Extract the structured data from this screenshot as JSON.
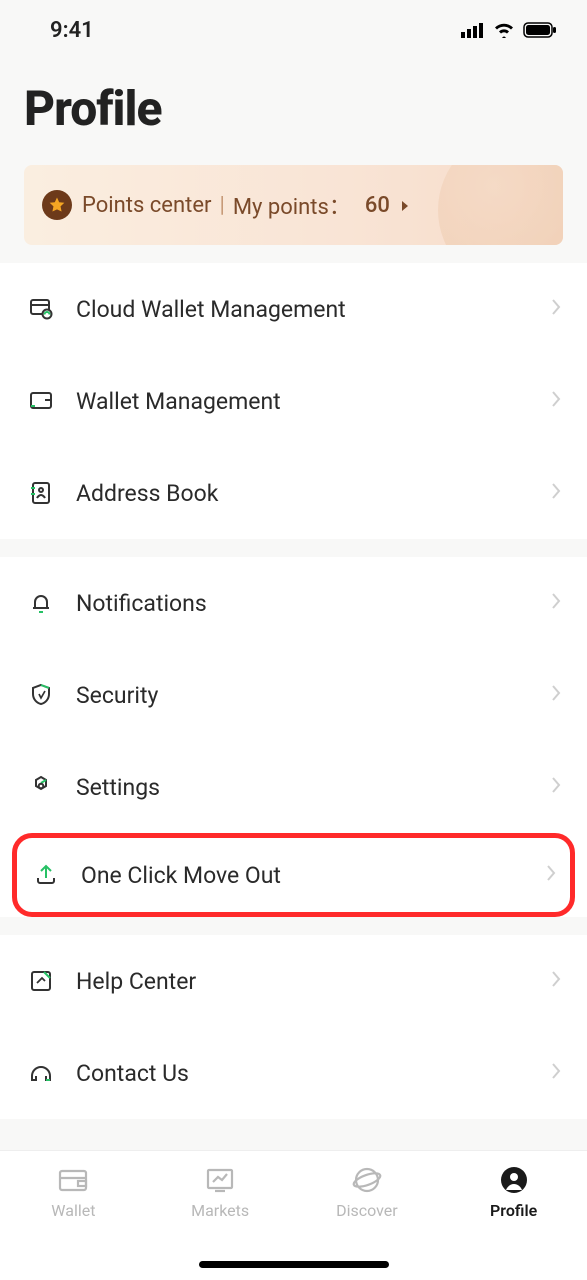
{
  "statusBar": {
    "time": "9:41"
  },
  "pageTitle": "Profile",
  "points": {
    "centerLabel": "Points center",
    "myPointsLabel": "My points：",
    "value": "60"
  },
  "group1": [
    {
      "icon": "cloud-wallet-icon",
      "label": "Cloud Wallet Management"
    },
    {
      "icon": "wallet-mgmt-icon",
      "label": "Wallet Management"
    },
    {
      "icon": "address-book-icon",
      "label": "Address Book"
    }
  ],
  "group2": [
    {
      "icon": "bell-icon",
      "label": "Notifications"
    },
    {
      "icon": "shield-icon",
      "label": "Security"
    },
    {
      "icon": "gear-icon",
      "label": "Settings"
    },
    {
      "icon": "upload-icon",
      "label": "One Click Move Out",
      "highlight": true
    }
  ],
  "group3": [
    {
      "icon": "help-icon",
      "label": "Help Center"
    },
    {
      "icon": "contact-icon",
      "label": "Contact Us"
    }
  ],
  "nav": [
    {
      "icon": "wallet-nav-icon",
      "label": "Wallet",
      "active": false
    },
    {
      "icon": "markets-nav-icon",
      "label": "Markets",
      "active": false
    },
    {
      "icon": "discover-nav-icon",
      "label": "Discover",
      "active": false
    },
    {
      "icon": "profile-nav-icon",
      "label": "Profile",
      "active": true
    }
  ]
}
